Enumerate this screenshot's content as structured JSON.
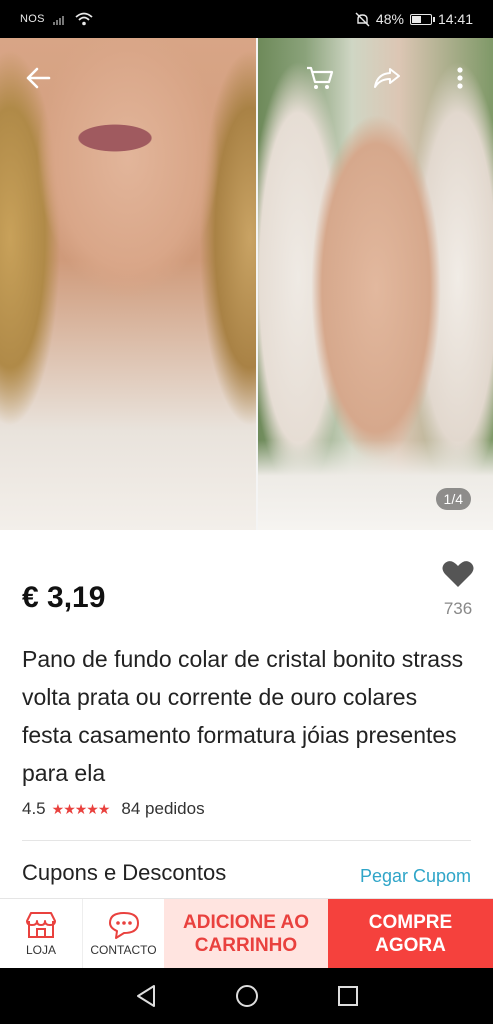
{
  "status_bar": {
    "carrier": "NOS",
    "battery": "48%",
    "time": "14:41",
    "battery_level": 0.48
  },
  "gallery": {
    "page_indicator": "1/4"
  },
  "product": {
    "price": "€ 3,19",
    "favorites_count": "736",
    "title": "Pano de fundo colar de cristal bonito strass volta prata ou corrente de ouro colares festa casamento formatura jóias presentes para ela",
    "rating": "4.5",
    "stars": "★★★★★",
    "orders": "84 pedidos"
  },
  "coupons": {
    "title": "Cupons e Descontos",
    "link": "Pegar Cupom"
  },
  "actions": {
    "store": "LOJA",
    "contact": "CONTACTO",
    "add_to_cart_line1": "ADICIONE AO",
    "add_to_cart_line2": "CARRINHO",
    "buy_now_line1": "COMPRE",
    "buy_now_line2": "AGORA"
  },
  "colors": {
    "accent_red": "#f5413d",
    "link_blue": "#2fa5c8",
    "add_cart_bg": "#ffe4e0"
  }
}
